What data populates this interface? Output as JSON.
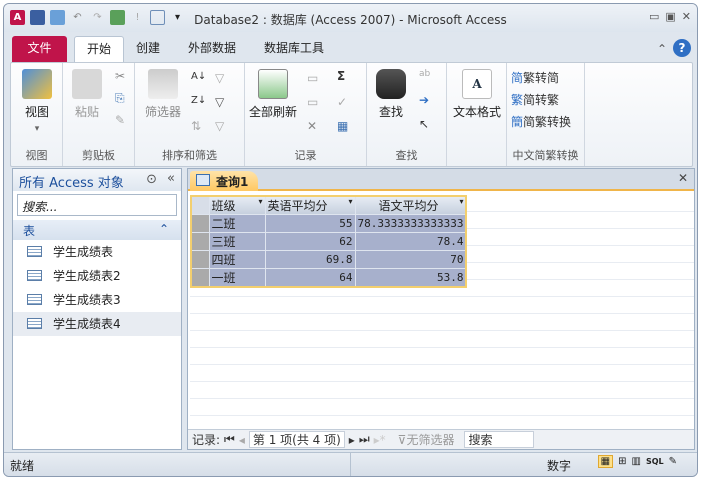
{
  "window": {
    "title": "Database2 : 数据库 (Access 2007)  -  Microsoft Access",
    "app_icon": "A"
  },
  "ribbon_tabs": [
    {
      "label": "文件"
    },
    {
      "label": "开始"
    },
    {
      "label": "创建"
    },
    {
      "label": "外部数据"
    },
    {
      "label": "数据库工具"
    }
  ],
  "groups": {
    "view": {
      "label": "视图",
      "button": "视图"
    },
    "clipboard": {
      "label": "剪贴板",
      "paste": "粘贴"
    },
    "sort": {
      "label": "排序和筛选",
      "filter": "筛选器"
    },
    "records": {
      "label": "记录",
      "refresh": "全部刷新",
      "sum": "Σ"
    },
    "find": {
      "label": "查找",
      "find": "查找"
    },
    "textfmt": {
      "label": "",
      "button": "文本格式",
      "glyph": "A"
    },
    "chinese": {
      "label": "中文简繁转换",
      "items": [
        "繁转简",
        "简转繁",
        "简繁转换"
      ]
    }
  },
  "nav": {
    "title": "所有 Access 对象",
    "search_placeholder": "搜索...",
    "section": "表",
    "items": [
      "学生成绩表",
      "学生成绩表2",
      "学生成绩表3",
      "学生成绩表4"
    ],
    "selected": 3
  },
  "doc": {
    "tab": "查询1",
    "columns": [
      "班级",
      "英语平均分",
      "语文平均分"
    ],
    "rows": [
      [
        "二班",
        "55",
        "78.3333333333333"
      ],
      [
        "三班",
        "62",
        "78.4"
      ],
      [
        "四班",
        "69.8",
        "70"
      ],
      [
        "一班",
        "64",
        "53.8"
      ]
    ]
  },
  "record_nav": {
    "label": "记录:",
    "position": "第 1 项(共 4 项)",
    "filter": "无筛选器",
    "search": "搜索"
  },
  "status": {
    "left": "就绪",
    "mode": "数字",
    "view_icons": [
      "datasheet-view-icon",
      "pivottable-icon",
      "pivotchart-icon",
      "sql-view-icon",
      "design-view-icon"
    ],
    "sql": "SQL"
  },
  "colors": {
    "file_tab": "#c0144a",
    "selection": "#a7b0cc",
    "accent": "#f0b54a"
  }
}
